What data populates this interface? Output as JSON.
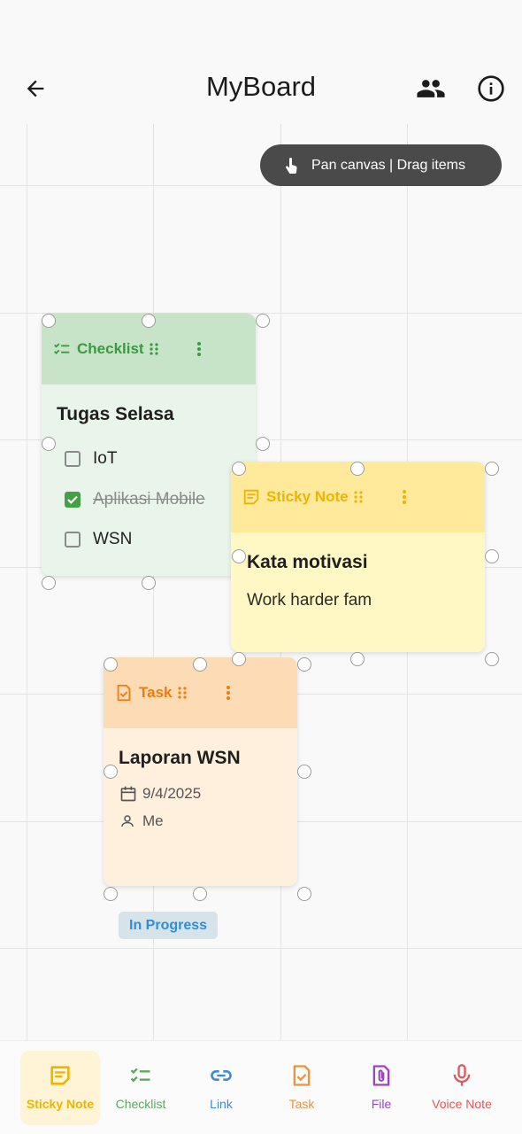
{
  "appbar": {
    "title": "MyBoard"
  },
  "hint": {
    "text": "Pan canvas | Drag items"
  },
  "checklist_card": {
    "type_label": "Checklist",
    "title": "Tugas Selasa",
    "items": [
      {
        "label": "IoT",
        "checked": false
      },
      {
        "label": "Aplikasi Mobile",
        "checked": true
      },
      {
        "label": "WSN",
        "checked": false
      }
    ]
  },
  "sticky_card": {
    "type_label": "Sticky Note",
    "title": "Kata motivasi",
    "content": "Work harder fam"
  },
  "task_card": {
    "type_label": "Task",
    "title": "Laporan WSN",
    "date": "9/4/2025",
    "assignee": "Me",
    "status": "In Progress"
  },
  "toolbar": {
    "active": "Sticky Note",
    "items": [
      {
        "label": "Sticky Note",
        "color": "#f0b400"
      },
      {
        "label": "Checklist",
        "color": "#5aa85e"
      },
      {
        "label": "Link",
        "color": "#3d8bd8"
      },
      {
        "label": "Task",
        "color": "#f0923a"
      },
      {
        "label": "File",
        "color": "#9c45c0"
      },
      {
        "label": "Voice Note",
        "color": "#e0575c"
      }
    ]
  },
  "colors": {
    "checklist_head": "#c7e3c8",
    "checklist_body": "#e9f5ea",
    "checklist_accent": "#3a9a3f",
    "sticky_head": "#ffe99a",
    "sticky_body": "#fff8c4",
    "sticky_accent": "#f0b400",
    "task_head": "#fddbb4",
    "task_body": "#fff0de",
    "task_accent": "#ee7d10"
  }
}
